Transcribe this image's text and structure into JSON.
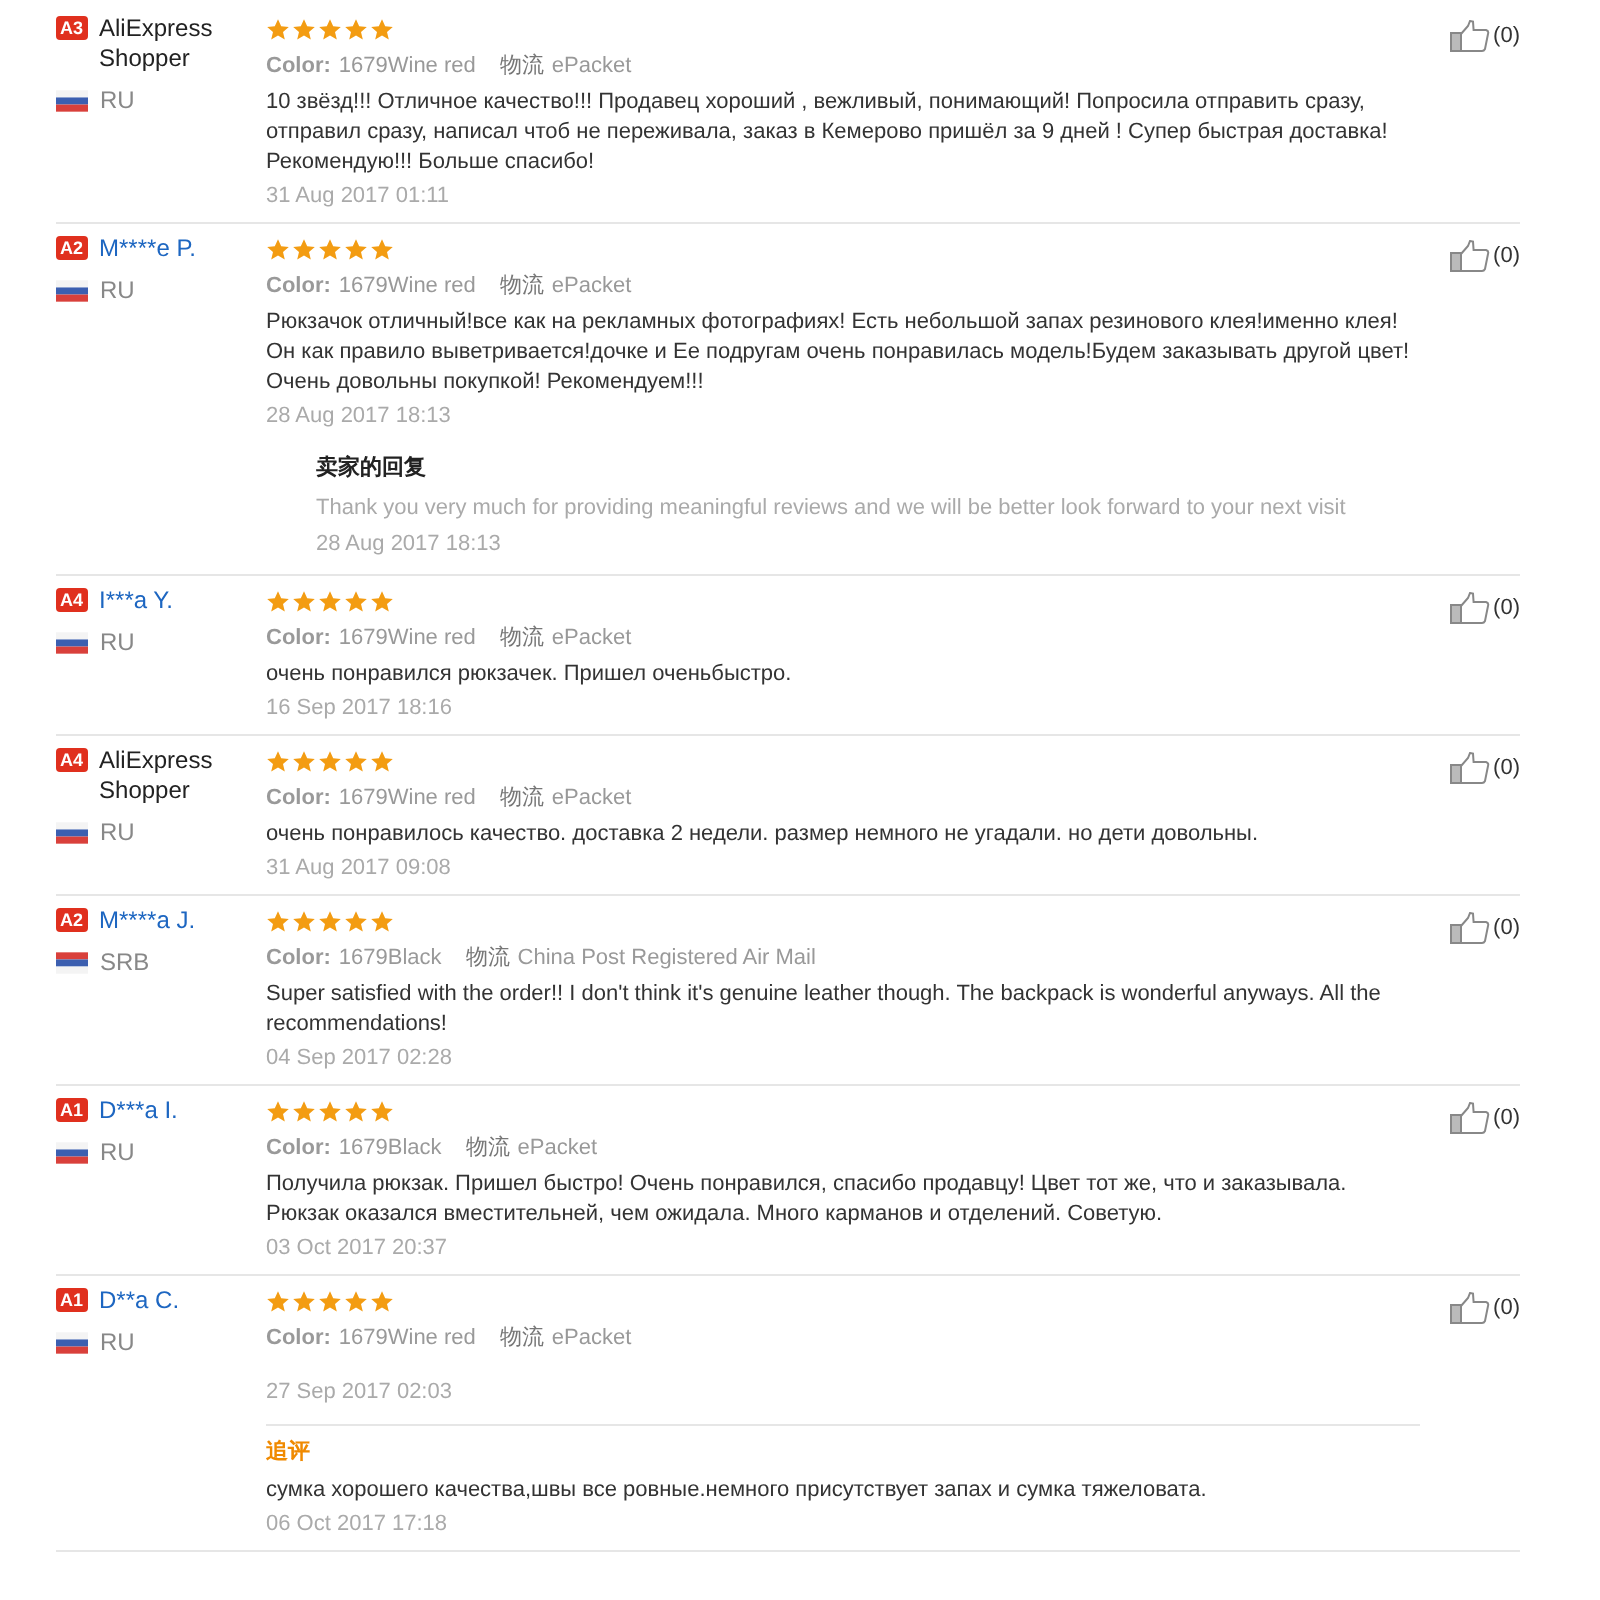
{
  "reviews": [
    {
      "badge": "A3",
      "name": "AliExpress Shopper",
      "linked": false,
      "flag": {
        "kind": "ru"
      },
      "country": "RU",
      "stars": 5,
      "color_label": "Color:",
      "color_value": "1679Wine red",
      "shipping_label": "物流",
      "shipping_value": "ePacket",
      "text": "10 звёзд!!! Отличное качество!!! Продавец хороший , вежливый, понимающий! Попросила отправить сразу, отправил сразу, написал чтоб не переживала, заказ в Кемерово пришёл за 9 дней ! Супер быстрая доставка! Рекомендую!!! Больше спасибо!",
      "date": "31 Aug 2017 01:11",
      "likes": "(0)"
    },
    {
      "badge": "A2",
      "name": "M****e P.",
      "linked": true,
      "flag": {
        "kind": "ru"
      },
      "country": "RU",
      "stars": 5,
      "color_label": "Color:",
      "color_value": "1679Wine red",
      "shipping_label": "物流",
      "shipping_value": "ePacket",
      "text": "Рюкзачок отличный!все как на рекламных фотографиях! Есть небольшой запах резинового клея!именно клея! Он как правило выветривается!дочке и Ее подругам очень понравилась модель!Будем заказывать другой цвет! Очень довольны покупкой! Рекомендуем!!!",
      "date": "28 Aug 2017 18:13",
      "likes": "(0)",
      "reply": {
        "title": "卖家的回复",
        "text": "Thank you very much for providing meaningful reviews and we will be better look forward to your next visit",
        "date": "28 Aug 2017 18:13"
      }
    },
    {
      "badge": "A4",
      "name": "I***a Y.",
      "linked": true,
      "flag": {
        "kind": "ru"
      },
      "country": "RU",
      "stars": 5,
      "color_label": "Color:",
      "color_value": "1679Wine red",
      "shipping_label": "物流",
      "shipping_value": "ePacket",
      "text": "очень понравился рюкзачек. Пришел оченьбыстро.",
      "date": "16 Sep 2017 18:16",
      "likes": "(0)"
    },
    {
      "badge": "A4",
      "name": "AliExpress Shopper",
      "linked": false,
      "flag": {
        "kind": "ru"
      },
      "country": "RU",
      "stars": 5,
      "color_label": "Color:",
      "color_value": "1679Wine red",
      "shipping_label": "物流",
      "shipping_value": "ePacket",
      "text": "очень понравилось качество. доставка 2 недели. размер немного не угадали. но дети довольны.",
      "date": "31 Aug 2017 09:08",
      "likes": "(0)"
    },
    {
      "badge": "A2",
      "name": "M****a J.",
      "linked": true,
      "flag": {
        "kind": "rs"
      },
      "country": "SRB",
      "stars": 5,
      "color_label": "Color:",
      "color_value": "1679Black",
      "shipping_label": "物流",
      "shipping_value": "China Post Registered Air Mail",
      "text": "Super satisfied with the order!! I don't think it's genuine leather though. The backpack is wonderful anyways. All the recommendations!",
      "date": "04 Sep 2017 02:28",
      "likes": "(0)"
    },
    {
      "badge": "A1",
      "name": "D***a I.",
      "linked": true,
      "flag": {
        "kind": "ru"
      },
      "country": "RU",
      "stars": 5,
      "color_label": "Color:",
      "color_value": "1679Black",
      "shipping_label": "物流",
      "shipping_value": "ePacket",
      "text": "Получила рюкзак. Пришел быстро! Очень понравился, спасибо продавцу! Цвет тот же, что и заказывала. Рюкзак оказался вместительней, чем ожидала. Много карманов и отделений. Советую.",
      "date": "03 Oct 2017 20:37",
      "likes": "(0)"
    },
    {
      "badge": "A1",
      "name": "D**a C.",
      "linked": true,
      "flag": {
        "kind": "ru"
      },
      "country": "RU",
      "stars": 5,
      "color_label": "Color:",
      "color_value": "1679Wine red",
      "shipping_label": "物流",
      "shipping_value": "ePacket",
      "date": "27 Sep 2017 02:03",
      "likes": "(0)",
      "followup": {
        "title": "追评",
        "text": "сумка хорошего качества,швы все ровные.немного присутствует запах и сумка тяжеловата.",
        "date": "06 Oct 2017 17:18"
      }
    }
  ]
}
